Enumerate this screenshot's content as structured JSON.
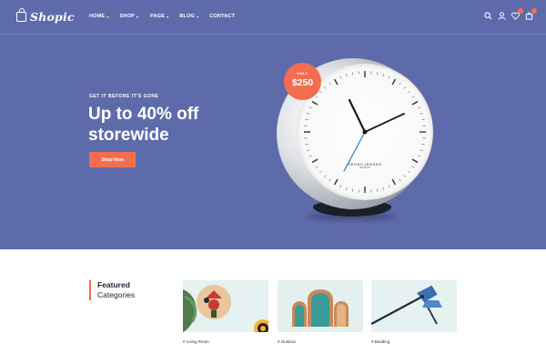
{
  "brand": {
    "logo_text": "Shopic"
  },
  "nav": {
    "items": [
      {
        "label": "HOME",
        "has_caret": true
      },
      {
        "label": "SHOP",
        "has_caret": true
      },
      {
        "label": "PAGE",
        "has_caret": true
      },
      {
        "label": "BLOG",
        "has_caret": true
      },
      {
        "label": "CONTACT",
        "has_caret": false
      }
    ],
    "caret_glyph": "▾"
  },
  "header_icons": [
    "search-icon",
    "user-icon",
    "heart-icon",
    "cart-icon"
  ],
  "hero": {
    "tagline": "GET IT BEFORE IT'S GONE",
    "headline": "Up to 40% off storewide",
    "cta_label": "Shop Now",
    "price_badge": {
      "label": "ONLY",
      "value": "$250"
    },
    "clock_brand": "GEORG JENSEN",
    "clock_brand_sub": "DENMARK",
    "background_color": "#5e6bab",
    "accent_color": "#f46d4f"
  },
  "featured": {
    "title": "Featured",
    "subtitle": "Categories"
  },
  "categories": [
    {
      "label": "# Living Room"
    },
    {
      "label": "# Outdoor"
    },
    {
      "label": "# Bedding"
    }
  ]
}
